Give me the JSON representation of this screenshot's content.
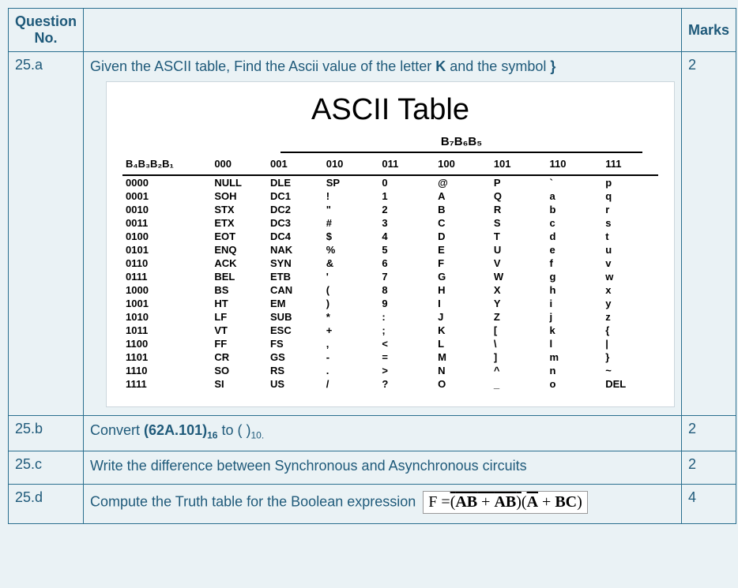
{
  "header": {
    "qno": "Question No.",
    "marks": "Marks"
  },
  "rows": [
    {
      "qno": "25.a",
      "marks": "2",
      "text_pre": "Given the ASCII table, Find the Ascii value of the letter ",
      "bold1": "K",
      "text_mid": " and the symbol ",
      "bold2": "}"
    },
    {
      "qno": "25.b",
      "marks": "2",
      "text_pre": "Convert ",
      "bold1": "(62A.101)",
      "sub1": "16",
      "text_mid": "  to  (     )",
      "sub2": "10."
    },
    {
      "qno": "25.c",
      "marks": "2",
      "text": "Write the difference between Synchronous and Asynchronous circuits"
    },
    {
      "qno": "25.d",
      "marks": "4",
      "text": "Compute the Truth table for the Boolean expression "
    }
  ],
  "ascii": {
    "title": "ASCII Table",
    "super_header": "B₇B₆B₅",
    "row_header": "B₄B₃B₂B₁",
    "col_headers": [
      "000",
      "001",
      "010",
      "011",
      "100",
      "101",
      "110",
      "111"
    ],
    "body": [
      [
        "0000",
        "NULL",
        "DLE",
        "SP",
        "0",
        "@",
        "P",
        "`",
        "p"
      ],
      [
        "0001",
        "SOH",
        "DC1",
        "!",
        "1",
        "A",
        "Q",
        "a",
        "q"
      ],
      [
        "0010",
        "STX",
        "DC2",
        "\"",
        "2",
        "B",
        "R",
        "b",
        "r"
      ],
      [
        "0011",
        "ETX",
        "DC3",
        "#",
        "3",
        "C",
        "S",
        "c",
        "s"
      ],
      [
        "0100",
        "EOT",
        "DC4",
        "$",
        "4",
        "D",
        "T",
        "d",
        "t"
      ],
      [
        "0101",
        "ENQ",
        "NAK",
        "%",
        "5",
        "E",
        "U",
        "e",
        "u"
      ],
      [
        "0110",
        "ACK",
        "SYN",
        "&",
        "6",
        "F",
        "V",
        "f",
        "v"
      ],
      [
        "0111",
        "BEL",
        "ETB",
        "'",
        "7",
        "G",
        "W",
        "g",
        "w"
      ],
      [
        "1000",
        "BS",
        "CAN",
        "(",
        "8",
        "H",
        "X",
        "h",
        "x"
      ],
      [
        "1001",
        "HT",
        "EM",
        ")",
        "9",
        "I",
        "Y",
        "i",
        "y"
      ],
      [
        "1010",
        "LF",
        "SUB",
        "*",
        ":",
        "J",
        "Z",
        "j",
        "z"
      ],
      [
        "1011",
        "VT",
        "ESC",
        "+",
        ";",
        "K",
        "[",
        "k",
        "{"
      ],
      [
        "1100",
        "FF",
        "FS",
        ",",
        "<",
        "L",
        "\\",
        "l",
        "|"
      ],
      [
        "1101",
        "CR",
        "GS",
        "-",
        "=",
        "M",
        "]",
        "m",
        "}"
      ],
      [
        "1110",
        "SO",
        "RS",
        ".",
        ">",
        "N",
        "^",
        "n",
        "~"
      ],
      [
        "1111",
        "SI",
        "US",
        "/",
        "?",
        "O",
        "_",
        "o",
        "DEL"
      ]
    ]
  },
  "formula": {
    "lhs": "F =",
    "group1_a": "AB",
    "group1_plus": " + ",
    "group1_b_bar": "A",
    "group1_b_rest": "B",
    "group2_a_bar": "A",
    "group2_plus": " + ",
    "group2_rest": "BC"
  }
}
